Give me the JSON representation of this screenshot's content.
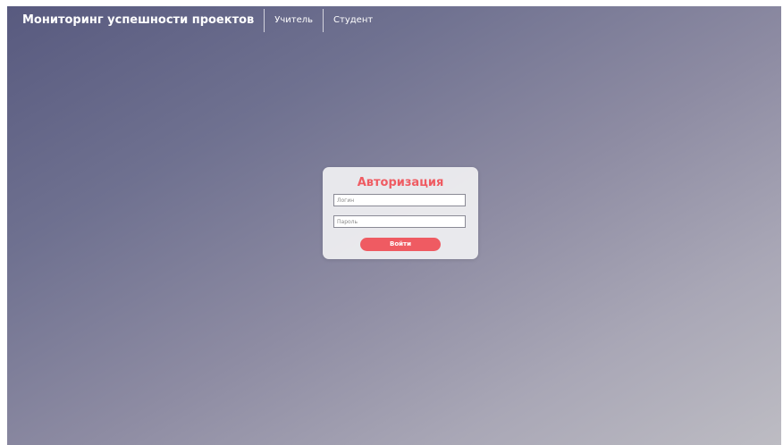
{
  "header": {
    "brand": "Мониторинг успешности проектов",
    "nav": [
      {
        "label": "Учитель"
      },
      {
        "label": "Студент"
      }
    ]
  },
  "login": {
    "title": "Авторизация",
    "login_placeholder": "Логин",
    "password_placeholder": "Пароль",
    "submit_label": "Войти"
  },
  "colors": {
    "accent": "#ef5b62",
    "gradient_start": "#585a7f",
    "gradient_end": "#bdbcc3"
  }
}
